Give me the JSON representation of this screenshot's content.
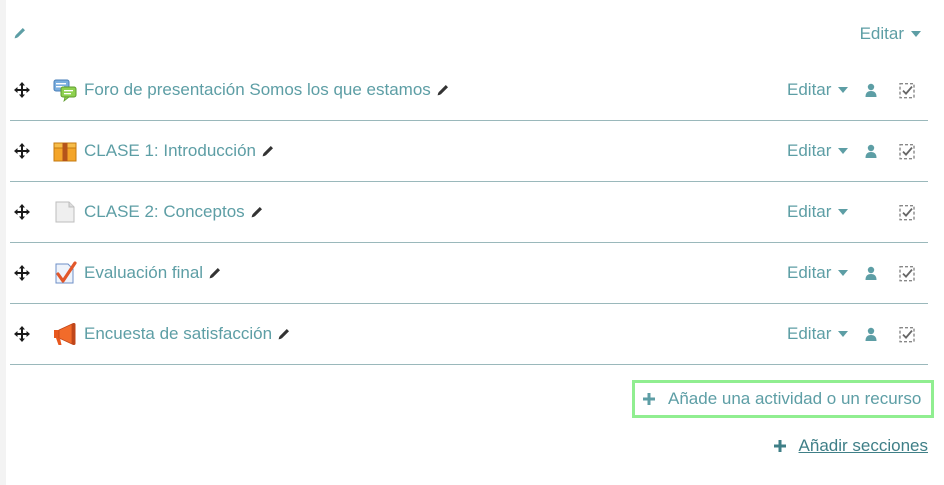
{
  "section": {
    "edit_label": "Editar"
  },
  "activities": [
    {
      "title": "Foro de presentación Somos los que estamos",
      "icon": "forum-icon",
      "edit_label": "Editar",
      "has_role_icon": true
    },
    {
      "title": "CLASE 1: Introducción",
      "icon": "package-icon",
      "edit_label": "Editar",
      "has_role_icon": true
    },
    {
      "title": "CLASE 2: Conceptos",
      "icon": "page-icon",
      "edit_label": "Editar",
      "has_role_icon": false
    },
    {
      "title": "Evaluación final",
      "icon": "quiz-icon",
      "edit_label": "Editar",
      "has_role_icon": true
    },
    {
      "title": "Encuesta de satisfacción",
      "icon": "feedback-icon",
      "edit_label": "Editar",
      "has_role_icon": true
    }
  ],
  "add_activity": {
    "label": "Añade una actividad o un recurso"
  },
  "add_sections": {
    "label": "Añadir secciones"
  },
  "colors": {
    "link": "#5d9ea5",
    "divider": "#9ab8bb",
    "highlight": "#90ee90"
  }
}
